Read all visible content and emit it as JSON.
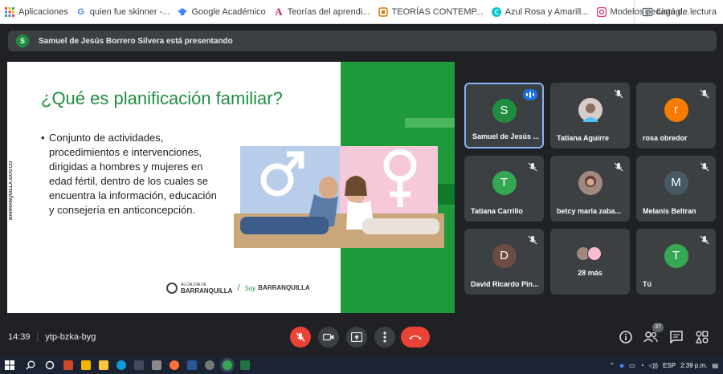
{
  "bookmarks": [
    {
      "label": "Aplicaciones",
      "icon": "apps-grid-icon",
      "color": "#ea4335"
    },
    {
      "label": "quien fue skinner -...",
      "icon": "google-icon",
      "color": "#4285f4"
    },
    {
      "label": "Google Académico",
      "icon": "scholar-icon",
      "color": "#4285f4"
    },
    {
      "label": "Teorías del aprendi...",
      "icon": "letter-a-icon",
      "color": "#c2185b"
    },
    {
      "label": "TEORÍAS CONTEMP...",
      "icon": "teorias-icon",
      "color": "#e37400"
    },
    {
      "label": "Azul Rosa y Amarill...",
      "icon": "canva-icon",
      "color": "#00c4cc"
    },
    {
      "label": "Modelos pedagógi...",
      "icon": "instagram-icon",
      "color": "#e1306c"
    }
  ],
  "reading_list": "Lista de lectura",
  "presenter_banner": {
    "avatar_letter": "S",
    "text": "Samuel de Jesús Borrero Silvera está presentando"
  },
  "slide": {
    "title": "¿Qué es planificación familiar?",
    "bullet": "Conjunto de actividades, procedimientos e intervenciones, dirigidas a hombres y mujeres en edad fértil, dentro de los cuales se encuentra la información, educación y consejería en anticoncepción.",
    "side_text": "BARRANQUILLA.GOV.CO",
    "logo_small": "ALCALDÍA DE",
    "logo_main": "BARRANQUILLA",
    "slogan_soy": "Soy",
    "slogan_city": "BARRANQUILLA"
  },
  "participants": [
    {
      "name": "Samuel de Jesús ...",
      "letter": "S",
      "color": "#1e8e3e",
      "speaking": true
    },
    {
      "name": "Tatiana Aguirre",
      "letter": "",
      "color": "#8d6e63",
      "speaking": false
    },
    {
      "name": "rosa obredor",
      "letter": "r",
      "color": "#f57c00",
      "speaking": false
    },
    {
      "name": "Tatiana Carrillo",
      "letter": "T",
      "color": "#34a853",
      "speaking": false
    },
    {
      "name": "betcy maria zaba...",
      "letter": "",
      "color": "#6d4c41",
      "speaking": false
    },
    {
      "name": "Melanis Beltran",
      "letter": "M",
      "color": "#455a64",
      "speaking": false
    },
    {
      "name": "David Ricardo Pin...",
      "letter": "D",
      "color": "#6d4c41",
      "speaking": false
    },
    {
      "name": "28 más",
      "letter": "",
      "color": "#5f6368",
      "speaking": false
    },
    {
      "name": "Tú",
      "letter": "T",
      "color": "#34a853",
      "speaking": false
    }
  ],
  "meeting": {
    "time": "14:39",
    "code": "ytp-bzka-byg",
    "participant_count": "37"
  },
  "taskbar": {
    "lang": "ESP",
    "clock": "2:39 p.m."
  }
}
